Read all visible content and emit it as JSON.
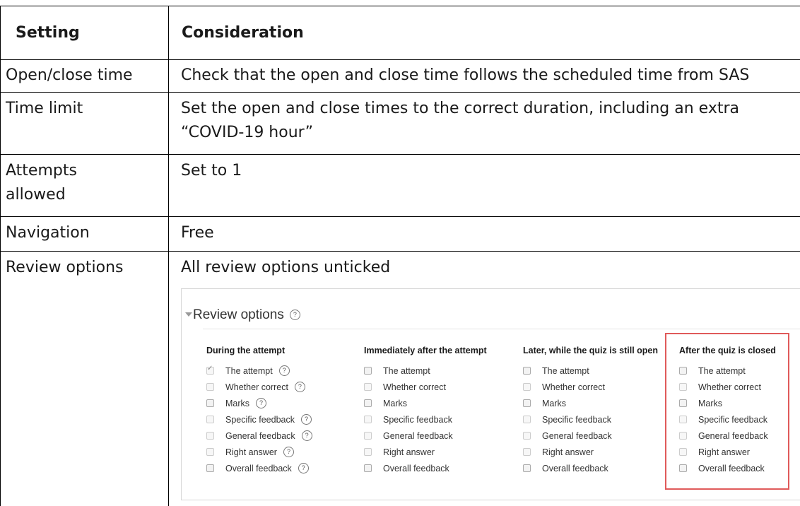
{
  "table": {
    "headers": [
      "Setting",
      "Consideration"
    ],
    "rows": [
      {
        "setting": "Open/close time",
        "consideration": "Check that the open and close time follows the scheduled time from SAS"
      },
      {
        "setting": "Time limit",
        "consideration_line1": "Set the open and close times to the correct duration, including an extra",
        "consideration_line2": "“COVID-19 hour”"
      },
      {
        "setting_line1": "Attempts",
        "setting_line2": "allowed",
        "consideration": "Set to 1"
      },
      {
        "setting": "Navigation",
        "consideration": "Free"
      },
      {
        "setting": "Review options",
        "consideration": "All review options unticked"
      }
    ]
  },
  "review_options": {
    "title": "Review options",
    "help_glyph": "?",
    "columns": [
      {
        "heading": "During the attempt",
        "items": [
          {
            "label": "The attempt",
            "checked": true,
            "help": true
          },
          {
            "label": "Whether correct",
            "checked": false,
            "help": true
          },
          {
            "label": "Marks",
            "checked": false,
            "help": true
          },
          {
            "label": "Specific feedback",
            "checked": false,
            "help": true
          },
          {
            "label": "General feedback",
            "checked": false,
            "help": true
          },
          {
            "label": "Right answer",
            "checked": false,
            "help": true
          },
          {
            "label": "Overall feedback",
            "checked": false,
            "help": true
          }
        ]
      },
      {
        "heading": "Immediately after the attempt",
        "items": [
          {
            "label": "The attempt",
            "checked": false
          },
          {
            "label": "Whether correct",
            "checked": false
          },
          {
            "label": "Marks",
            "checked": false
          },
          {
            "label": "Specific feedback",
            "checked": false
          },
          {
            "label": "General feedback",
            "checked": false
          },
          {
            "label": "Right answer",
            "checked": false
          },
          {
            "label": "Overall feedback",
            "checked": false
          }
        ]
      },
      {
        "heading": "Later, while the quiz is still open",
        "items": [
          {
            "label": "The attempt",
            "checked": false
          },
          {
            "label": "Whether correct",
            "checked": false
          },
          {
            "label": "Marks",
            "checked": false
          },
          {
            "label": "Specific feedback",
            "checked": false
          },
          {
            "label": "General feedback",
            "checked": false
          },
          {
            "label": "Right answer",
            "checked": false
          },
          {
            "label": "Overall feedback",
            "checked": false
          }
        ]
      },
      {
        "heading": "After the quiz is closed",
        "items": [
          {
            "label": "The attempt",
            "checked": false
          },
          {
            "label": "Whether correct",
            "checked": false
          },
          {
            "label": "Marks",
            "checked": false
          },
          {
            "label": "Specific feedback",
            "checked": false
          },
          {
            "label": "General feedback",
            "checked": false
          },
          {
            "label": "Right answer",
            "checked": false
          },
          {
            "label": "Overall feedback",
            "checked": false
          }
        ]
      }
    ],
    "highlight_color": "#e05a5a"
  }
}
